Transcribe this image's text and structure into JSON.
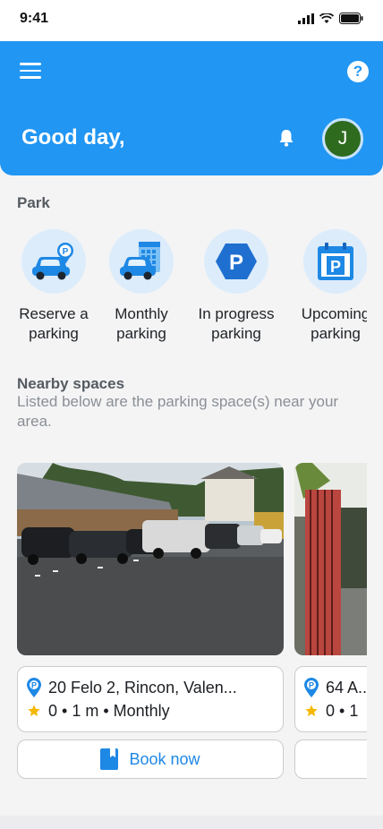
{
  "status_bar": {
    "time": "9:41"
  },
  "header": {
    "greeting": "Good day,",
    "avatar_initial": "J"
  },
  "park": {
    "title": "Park",
    "items": [
      {
        "line1": "Reserve a",
        "line2": "parking",
        "icon": "car-pin-icon"
      },
      {
        "line1": "Monthly",
        "line2": "parking",
        "icon": "car-calendar-icon"
      },
      {
        "line1": "In progress",
        "line2": "parking",
        "icon": "parking-hexagon-icon"
      },
      {
        "line1": "Upcoming",
        "line2": "parking",
        "icon": "parking-calendar-icon"
      }
    ]
  },
  "nearby": {
    "title": "Nearby spaces",
    "subtitle": "Listed below are the parking space(s) near your area.",
    "cards": [
      {
        "address": "20 Felo 2, Rincon, Valen...",
        "rating": "0",
        "distance": "1 m",
        "type": "Monthly",
        "book_label": "Book now"
      },
      {
        "address": "64 A...",
        "rating": "0",
        "distance": "1",
        "type": "",
        "book_label": ""
      }
    ]
  },
  "colors": {
    "primary": "#2196f3",
    "accent_text": "#1e88e5",
    "star": "#f5b800",
    "avatar_bg": "#2e6b1f"
  }
}
